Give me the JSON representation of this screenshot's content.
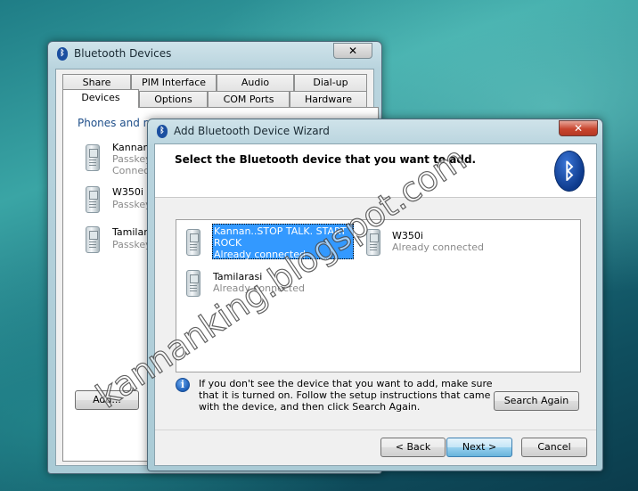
{
  "background_window": {
    "title": "Bluetooth Devices",
    "close_glyph": "✕",
    "tabs_row1": [
      "Share",
      "PIM Interface",
      "Audio",
      "Dial-up"
    ],
    "tabs_row2": [
      "Devices",
      "Options",
      "COM Ports",
      "Hardware"
    ],
    "group_label": "Phones and m",
    "devices": [
      {
        "name": "Kannan..",
        "lines": [
          "Passkey",
          "Connect"
        ]
      },
      {
        "name": "W350i",
        "lines": [
          "Passkey"
        ]
      },
      {
        "name": "Tamilara",
        "lines": [
          "Passkey"
        ]
      }
    ],
    "add_button": "Add..."
  },
  "wizard": {
    "title": "Add Bluetooth Device Wizard",
    "close_glyph": "✕",
    "heading": "Select the Bluetooth device that you want to add.",
    "bluetooth_logo": "ᛒ",
    "devices": [
      {
        "name_line1": "Kannan..STOP TALK. START",
        "name_line2": "ROCK",
        "status": "Already connected",
        "selected": true
      },
      {
        "name_line1": "W350i",
        "status": "Already connected"
      },
      {
        "name_line1": "Tamilarasi",
        "status": "Already connected"
      }
    ],
    "info_glyph": "i",
    "info_text": "If you don't see the device that you want to add, make sure that it is turned on. Follow the setup instructions that came with the device, and then click Search Again.",
    "search_again": "Search Again",
    "back": "< Back",
    "next": "Next >",
    "cancel": "Cancel"
  },
  "watermark": "kannanking.blogspot.com",
  "colors": {
    "selection": "#3399ff",
    "heading_blue": "#1f4f8a",
    "bluetooth_blue": "#1b4fa0"
  }
}
